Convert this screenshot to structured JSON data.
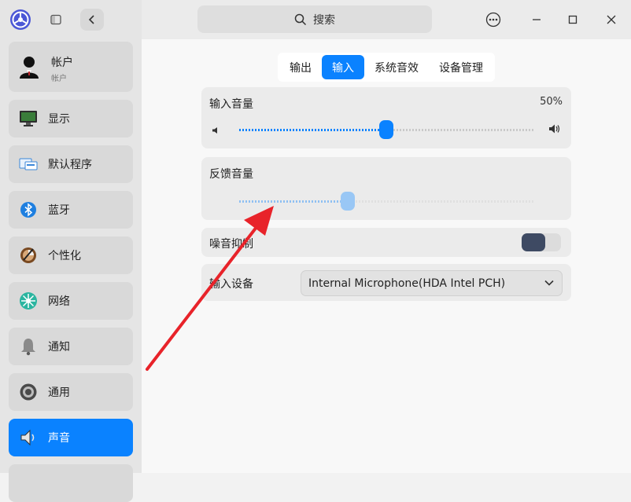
{
  "sidebar": {
    "account": {
      "title": "帐户",
      "subtitle": "帐户"
    },
    "items": [
      {
        "label": "显示",
        "icon": "monitor-icon"
      },
      {
        "label": "默认程序",
        "icon": "default-apps-icon"
      },
      {
        "label": "蓝牙",
        "icon": "bluetooth-icon"
      },
      {
        "label": "个性化",
        "icon": "personalization-icon"
      },
      {
        "label": "网络",
        "icon": "network-icon"
      },
      {
        "label": "通知",
        "icon": "bell-icon"
      },
      {
        "label": "通用",
        "icon": "general-icon"
      },
      {
        "label": "声音",
        "icon": "speaker-icon",
        "active": true
      }
    ]
  },
  "titlebar": {
    "search_placeholder": "搜索"
  },
  "tabs": [
    {
      "label": "输出"
    },
    {
      "label": "输入",
      "active": true
    },
    {
      "label": "系统音效"
    },
    {
      "label": "设备管理"
    }
  ],
  "input_volume": {
    "label": "输入音量",
    "percent_text": "50%",
    "value": 0.5
  },
  "feedback_volume": {
    "label": "反馈音量",
    "value": 0.37
  },
  "noise_suppression": {
    "label": "噪音抑制",
    "enabled": false
  },
  "input_device": {
    "label": "输入设备",
    "value": "Internal Microphone(HDA Intel PCH)"
  },
  "colors": {
    "accent": "#0a82ff",
    "annotation_arrow": "#e8232a"
  }
}
